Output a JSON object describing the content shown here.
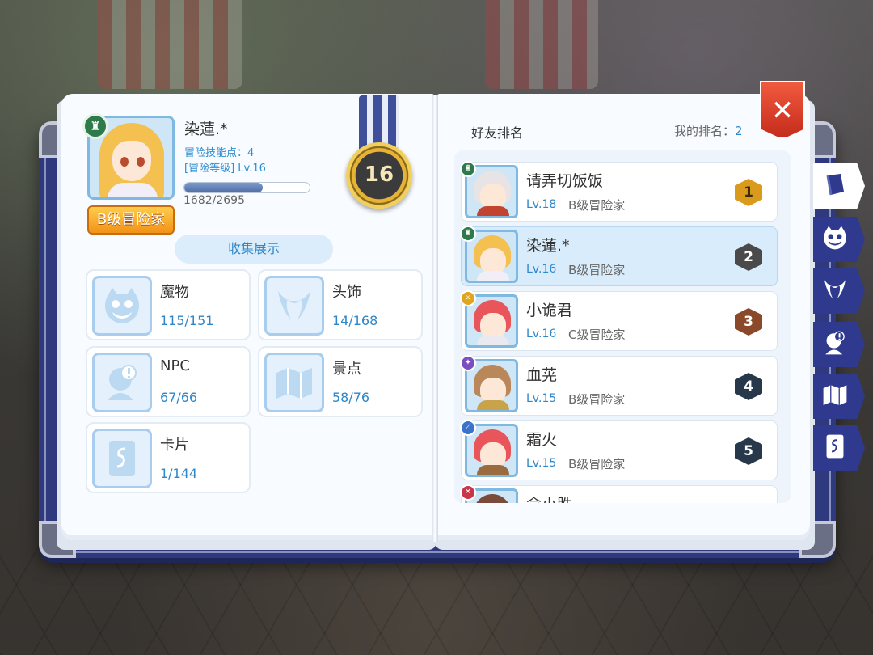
{
  "profile": {
    "name": "染蓮.*",
    "skill_points": "冒险技能点：4",
    "adventure_level": "[冒险等级] Lv.16",
    "exp_text": "1682/2695",
    "exp_fraction": 0.624,
    "rank_label": "B级冒险家",
    "level_medal": "16"
  },
  "collection": {
    "button_label": "收集展示",
    "categories": [
      {
        "name": "魔物",
        "count": "115/151",
        "icon": "monster-icon"
      },
      {
        "name": "头饰",
        "count": "14/168",
        "icon": "headwear-icon"
      },
      {
        "name": "NPC",
        "count": "67/66",
        "icon": "npc-icon"
      },
      {
        "name": "景点",
        "count": "58/76",
        "icon": "scenery-map-icon"
      },
      {
        "name": "卡片",
        "count": "1/144",
        "icon": "card-icon"
      }
    ]
  },
  "ranking": {
    "title": "好友排名",
    "my_rank_label": "我的排名：",
    "my_rank_value": "2",
    "rows": [
      {
        "name": "请弄切饭饭",
        "level": "Lv.18",
        "title": "B级冒险家",
        "rank": "1"
      },
      {
        "name": "染蓮.*",
        "level": "Lv.16",
        "title": "B级冒险家",
        "rank": "2"
      },
      {
        "name": "小诡君",
        "level": "Lv.16",
        "title": "C级冒险家",
        "rank": "3"
      },
      {
        "name": "血茪",
        "level": "Lv.15",
        "title": "B级冒险家",
        "rank": "4"
      },
      {
        "name": "霜火",
        "level": "Lv.15",
        "title": "B级冒险家",
        "rank": "5"
      },
      {
        "name": "俞小胜",
        "level": "",
        "title": "",
        "rank": ""
      }
    ]
  },
  "close_label": "✕",
  "side_tabs": [
    {
      "icon": "book-icon",
      "active": true
    },
    {
      "icon": "monster-icon",
      "active": false
    },
    {
      "icon": "headwear-icon",
      "active": false
    },
    {
      "icon": "npc-icon",
      "active": false
    },
    {
      "icon": "scenery-map-icon",
      "active": false
    },
    {
      "icon": "card-icon",
      "active": false
    }
  ],
  "colors": {
    "accent_blue": "#2f86c8",
    "book_navy": "#2f3a7e",
    "rank_gold": "#d99a1e",
    "rank_silver": "#4a4a4a",
    "rank_bronze": "#8a4a2a",
    "close_red": "#d9381f"
  }
}
